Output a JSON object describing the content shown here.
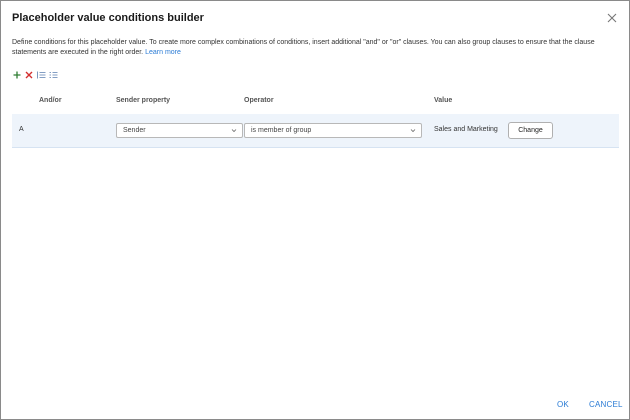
{
  "dialog": {
    "title": "Placeholder value conditions builder",
    "close_icon": "close-icon",
    "description": "Define conditions for this placeholder value. To create more complex combinations of conditions, insert additional \"and\" or \"or\" clauses. You can also group clauses to ensure that the clause statements are executed in the right order.",
    "learn_more": "Learn more"
  },
  "toolbar": {
    "icons": [
      "add-icon",
      "delete-icon",
      "group-clauses-icon",
      "ungroup-clauses-icon"
    ],
    "colors": {
      "add": "#2e7d32",
      "delete": "#d32f2f",
      "group": "#5b7fb0"
    }
  },
  "table": {
    "headers": {
      "andor": "And/or",
      "sender_property": "Sender property",
      "operator": "Operator",
      "value": "Value"
    },
    "row": {
      "andor": "A",
      "sender_property": "Sender",
      "operator": "is member of group",
      "value": "Sales and Marketing",
      "change_label": "Change"
    }
  },
  "footer": {
    "ok_label": "OK",
    "cancel_label": "CANCEL"
  }
}
